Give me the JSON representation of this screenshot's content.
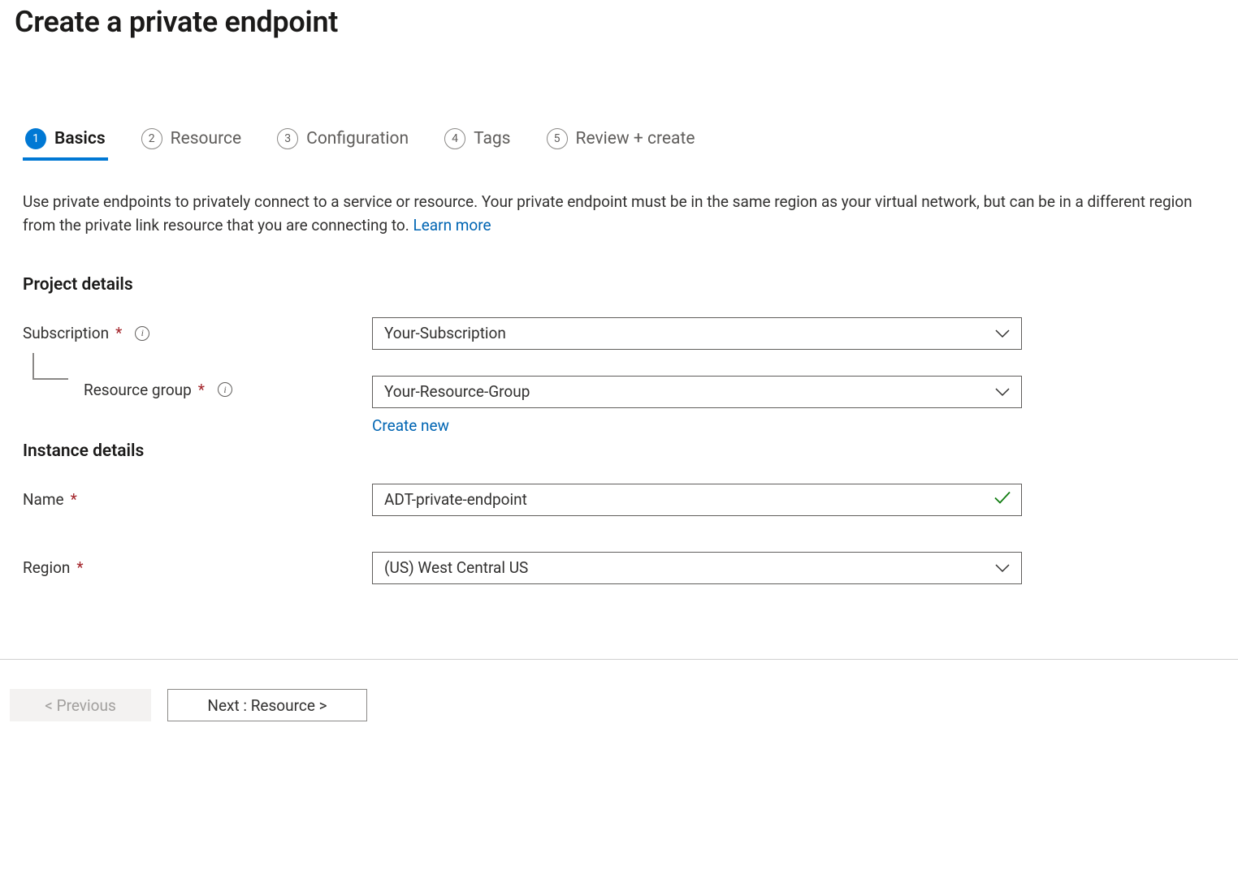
{
  "page": {
    "title": "Create a private endpoint"
  },
  "tabs": [
    {
      "num": "1",
      "label": "Basics"
    },
    {
      "num": "2",
      "label": "Resource"
    },
    {
      "num": "3",
      "label": "Configuration"
    },
    {
      "num": "4",
      "label": "Tags"
    },
    {
      "num": "5",
      "label": "Review + create"
    }
  ],
  "description": {
    "text": "Use private endpoints to privately connect to a service or resource. Your private endpoint must be in the same region as your virtual network, but can be in a different region from the private link resource that you are connecting to.  ",
    "learn_more": "Learn more"
  },
  "sections": {
    "project": {
      "heading": "Project details",
      "subscription_label": "Subscription",
      "subscription_value": "Your-Subscription",
      "resource_group_label": "Resource group",
      "resource_group_value": "Your-Resource-Group",
      "create_new": "Create new"
    },
    "instance": {
      "heading": "Instance details",
      "name_label": "Name",
      "name_value": "ADT-private-endpoint",
      "region_label": "Region",
      "region_value": "(US) West Central US"
    }
  },
  "footer": {
    "previous": "< Previous",
    "next": "Next : Resource >"
  }
}
